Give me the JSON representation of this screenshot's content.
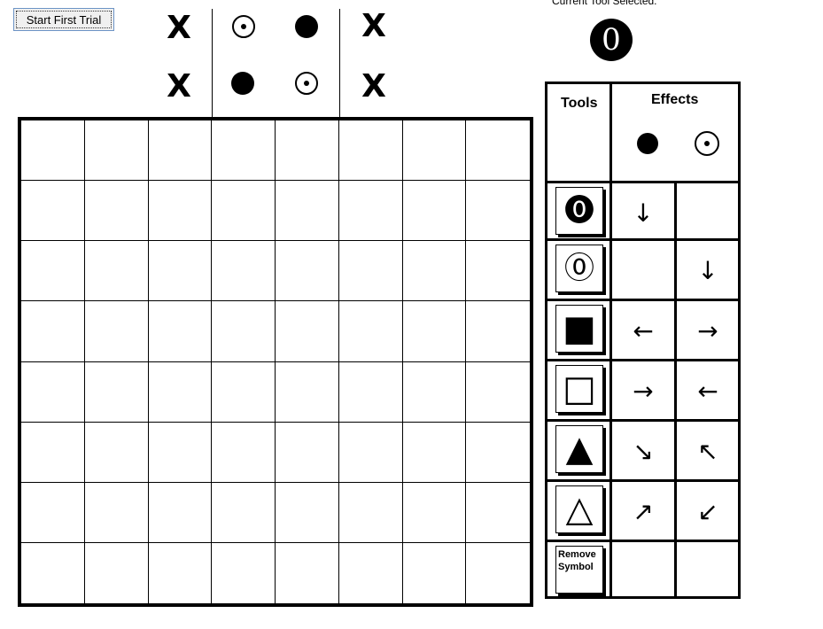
{
  "controls": {
    "start_button": "Start First Trial"
  },
  "legend": {
    "x_mark": "X",
    "row1": [
      "target",
      "filled"
    ],
    "row2": [
      "filled",
      "target"
    ]
  },
  "current_tool": {
    "label": "Current Tool Selected:",
    "symbol": "0"
  },
  "panel": {
    "tools_header": "Tools",
    "effects_header": "Effects",
    "effect_columns": [
      "filled-circle-icon",
      "target-circle-icon"
    ],
    "tools": [
      {
        "name": "filled-zero-tool",
        "glyph": "⓿",
        "effects": [
          "↓",
          ""
        ]
      },
      {
        "name": "outline-zero-tool",
        "glyph": "⓪",
        "effects": [
          "",
          "↓"
        ]
      },
      {
        "name": "filled-square-tool",
        "glyph": "■",
        "effects": [
          "←",
          "→"
        ]
      },
      {
        "name": "outline-square-tool",
        "glyph": "□",
        "effects": [
          "→",
          "←"
        ]
      },
      {
        "name": "filled-triangle-tool",
        "glyph": "▲",
        "effects": [
          "↘",
          "↖"
        ]
      },
      {
        "name": "outline-triangle-tool",
        "glyph": "△",
        "effects": [
          "↗",
          "↙"
        ]
      },
      {
        "name": "remove-symbol-tool",
        "glyph": "",
        "label": "Remove Symbol",
        "effects": [
          "",
          ""
        ]
      }
    ]
  }
}
